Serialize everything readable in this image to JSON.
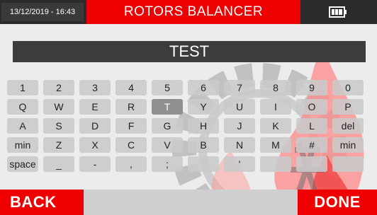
{
  "header": {
    "datetime": "13/12/2019 - 16:43",
    "title": "ROTORS BALANCER",
    "battery_icon": "battery-icon"
  },
  "text_field": {
    "value": "TEST"
  },
  "keyboard": {
    "rows": [
      [
        "1",
        "2",
        "3",
        "4",
        "5",
        "6",
        "7",
        "8",
        "9",
        "0"
      ],
      [
        "Q",
        "W",
        "E",
        "R",
        "T",
        "Y",
        "U",
        "I",
        "O",
        "P"
      ],
      [
        "A",
        "S",
        "D",
        "F",
        "G",
        "H",
        "J",
        "K",
        "L",
        "del"
      ],
      [
        "min",
        "Z",
        "X",
        "C",
        "V",
        "B",
        "N",
        "M",
        "#",
        "min"
      ],
      [
        "space",
        "_",
        "-",
        ",",
        ";",
        "",
        "'",
        "",
        "",
        ""
      ]
    ],
    "selected": "T"
  },
  "footer": {
    "back_label": "BACK",
    "done_label": "DONE"
  },
  "colors": {
    "accent": "#ee0000",
    "bar": "#2b2b2b",
    "key": "#c9c9c9",
    "key_selected": "#8f8f8f"
  }
}
